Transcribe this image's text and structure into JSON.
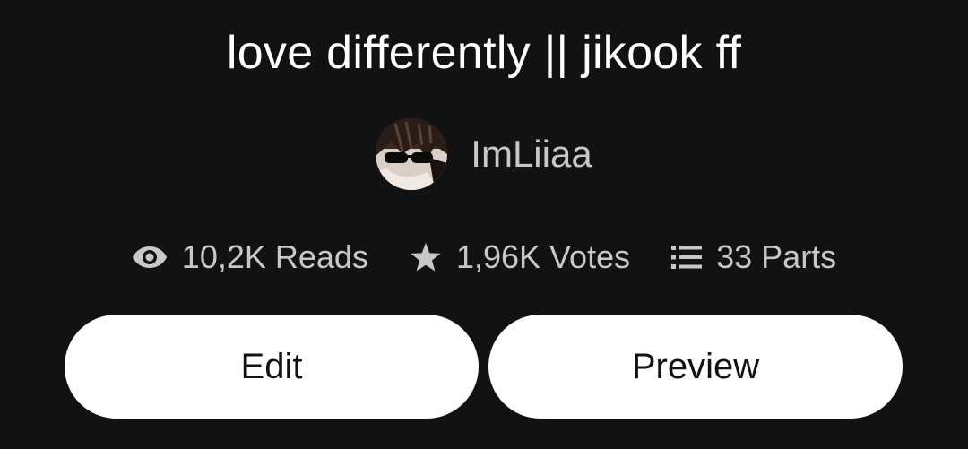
{
  "story": {
    "title": "love differently || jikook ff",
    "author": "ImLiiaa"
  },
  "stats": {
    "reads_label": "10,2K Reads",
    "reads_icon": "eye-icon",
    "votes_label": "1,96K Votes",
    "votes_icon": "star-icon",
    "parts_label": "33 Parts",
    "parts_icon": "list-icon"
  },
  "actions": {
    "edit_label": "Edit",
    "preview_label": "Preview"
  },
  "colors": {
    "background": "#121212",
    "title_text": "#ffffff",
    "secondary_text": "#c8c8c8",
    "button_background": "#ffffff",
    "button_text": "#121212"
  }
}
